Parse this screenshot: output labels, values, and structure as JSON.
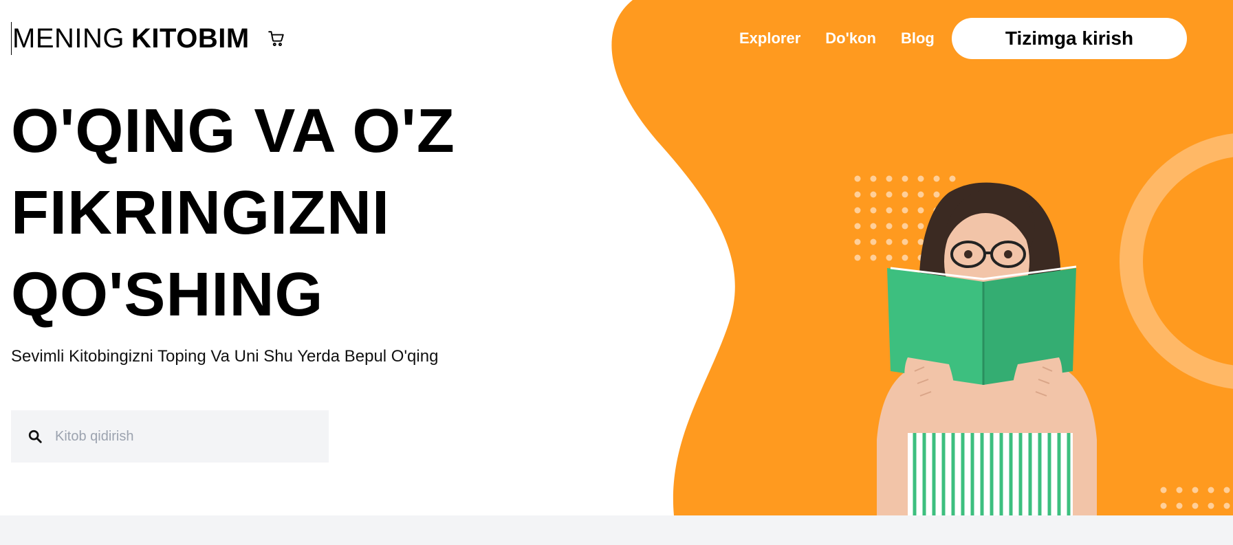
{
  "header": {
    "logo_light": "MENING",
    "logo_bold": "KITOBIM",
    "cart_icon": "cart-icon",
    "nav": [
      {
        "label": "Explorer"
      },
      {
        "label": "Do'kon"
      },
      {
        "label": "Blog"
      }
    ],
    "login_label": "Tizimga kirish"
  },
  "hero": {
    "headline": "O'QING VA O'Z FIKRINGIZNI QO'SHING",
    "subtitle": "Sevimli Kitobingizni Toping Va Uni Shu Yerda Bepul O'qing",
    "search_placeholder": "Kitob qidirish",
    "search_value": "",
    "search_icon": "search-icon"
  },
  "colors": {
    "accent": "#ff9a1f",
    "accent_ring": "#ffb866",
    "book": "#3dbf7f",
    "band": "#f3f4f6"
  }
}
